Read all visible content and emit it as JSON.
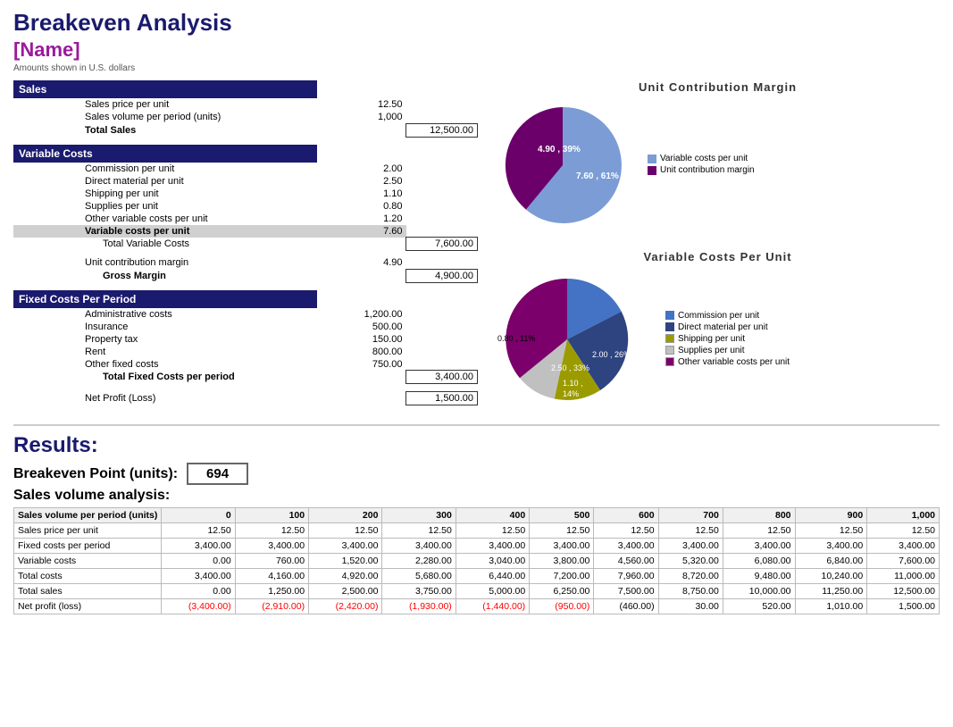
{
  "header": {
    "title": "Breakeven Analysis",
    "name": "[Name]",
    "subtitle": "Amounts shown in U.S. dollars"
  },
  "sections": {
    "sales": {
      "header": "Sales",
      "rows": [
        {
          "label": "Sales price per unit",
          "value": "12.50"
        },
        {
          "label": "Sales volume per period (units)",
          "value": "1,000"
        },
        {
          "label": "Total Sales",
          "value": "12,500.00"
        }
      ]
    },
    "variableCosts": {
      "header": "Variable Costs",
      "rows": [
        {
          "label": "Commission per unit",
          "value": "2.00"
        },
        {
          "label": "Direct material per unit",
          "value": "2.50"
        },
        {
          "label": "Shipping per unit",
          "value": "1.10"
        },
        {
          "label": "Supplies per unit",
          "value": "0.80"
        },
        {
          "label": "Other variable costs per unit",
          "value": "1.20"
        },
        {
          "label": "Variable costs per unit",
          "value": "7.60"
        },
        {
          "label": "Total Variable Costs",
          "value": "7,600.00"
        }
      ]
    },
    "contribution": {
      "rows": [
        {
          "label": "Unit contribution margin",
          "value": "4.90"
        },
        {
          "label": "Gross Margin",
          "value": "4,900.00"
        }
      ]
    },
    "fixedCosts": {
      "header": "Fixed Costs Per Period",
      "rows": [
        {
          "label": "Administrative costs",
          "value": "1,200.00"
        },
        {
          "label": "Insurance",
          "value": "500.00"
        },
        {
          "label": "Property tax",
          "value": "150.00"
        },
        {
          "label": "Rent",
          "value": "800.00"
        },
        {
          "label": "Other fixed costs",
          "value": "750.00"
        },
        {
          "label": "Total Fixed Costs per period",
          "value": "3,400.00"
        }
      ]
    },
    "netProfit": {
      "label": "Net Profit (Loss)",
      "value": "1,500.00"
    }
  },
  "charts": {
    "unitContribution": {
      "title": "Unit  Contribution  Margin",
      "legend": [
        "Variable costs per unit",
        "Unit contribution margin"
      ]
    },
    "variableCosts": {
      "title": "Variable  Costs  Per  Unit",
      "legend": [
        "Commission per unit",
        "Direct material per unit",
        "Shipping per unit",
        "Supplies per unit",
        "Other variable costs per unit"
      ]
    }
  },
  "results": {
    "title": "Results:",
    "breakevenLabel": "Breakeven Point (units):",
    "breakevenValue": "694",
    "salesVolumeTitle": "Sales volume analysis:",
    "tableHeaders": [
      "Sales volume per period (units)",
      "0",
      "100",
      "200",
      "300",
      "400",
      "500",
      "600",
      "700",
      "800",
      "900",
      "1,000"
    ],
    "tableRows": [
      {
        "label": "Sales price per unit",
        "values": [
          "12.50",
          "12.50",
          "12.50",
          "12.50",
          "12.50",
          "12.50",
          "12.50",
          "12.50",
          "12.50",
          "12.50",
          "12.50"
        ],
        "red": false
      },
      {
        "label": "Fixed costs per period",
        "values": [
          "3,400.00",
          "3,400.00",
          "3,400.00",
          "3,400.00",
          "3,400.00",
          "3,400.00",
          "3,400.00",
          "3,400.00",
          "3,400.00",
          "3,400.00",
          "3,400.00"
        ],
        "red": false
      },
      {
        "label": "Variable costs",
        "values": [
          "0.00",
          "760.00",
          "1,520.00",
          "2,280.00",
          "3,040.00",
          "3,800.00",
          "4,560.00",
          "5,320.00",
          "6,080.00",
          "6,840.00",
          "7,600.00"
        ],
        "red": false
      },
      {
        "label": "Total costs",
        "values": [
          "3,400.00",
          "4,160.00",
          "4,920.00",
          "5,680.00",
          "6,440.00",
          "7,200.00",
          "7,960.00",
          "8,720.00",
          "9,480.00",
          "10,240.00",
          "11,000.00"
        ],
        "red": false
      },
      {
        "label": "Total sales",
        "values": [
          "0.00",
          "1,250.00",
          "2,500.00",
          "3,750.00",
          "5,000.00",
          "6,250.00",
          "7,500.00",
          "8,750.00",
          "10,000.00",
          "11,250.00",
          "12,500.00"
        ],
        "red": false
      },
      {
        "label": "Net profit (loss)",
        "values": [
          "(3,400.00)",
          "(2,910.00)",
          "(2,420.00)",
          "(1,930.00)",
          "(1,440.00)",
          "(950.00)",
          "(460.00)",
          "30.00",
          "520.00",
          "1,010.00",
          "1,500.00"
        ],
        "red": true,
        "partial": 6
      }
    ]
  }
}
